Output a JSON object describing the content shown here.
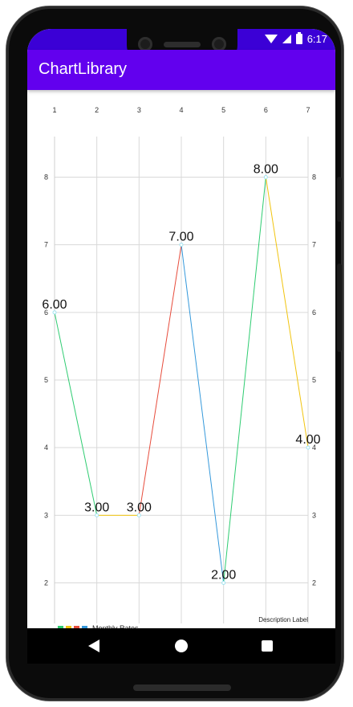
{
  "status_bar": {
    "time": "6:17"
  },
  "app_bar": {
    "title": "ChartLibrary"
  },
  "chart_data": {
    "type": "line",
    "x": [
      1,
      2,
      3,
      4,
      5,
      6,
      7
    ],
    "values": [
      6.0,
      3.0,
      3.0,
      7.0,
      2.0,
      8.0,
      4.0
    ],
    "value_labels": [
      "6.00",
      "3.00",
      "3.00",
      "7.00",
      "2.00",
      "8.00",
      "4.00"
    ],
    "segment_colors": [
      "#2ecc71",
      "#f1c40f",
      "#e74c3c",
      "#3498db",
      "#2ecc71",
      "#f1c40f"
    ],
    "x_ticks": [
      "1",
      "2",
      "3",
      "4",
      "5",
      "6",
      "7"
    ],
    "y_ticks": [
      "2",
      "3",
      "4",
      "5",
      "6",
      "7",
      "8"
    ],
    "ylim": [
      1.4,
      8.6
    ],
    "grid": true,
    "description": "Description Label",
    "legend": {
      "label": "Monthly Rates",
      "colors": [
        "#2ecc71",
        "#f1c40f",
        "#e74c3c",
        "#3498db"
      ],
      "position": "bottom-left"
    }
  }
}
